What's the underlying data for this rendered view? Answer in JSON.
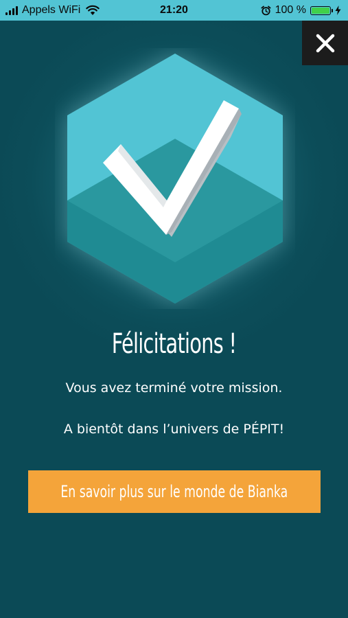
{
  "status_bar": {
    "carrier": "Appels WiFi",
    "time": "21:20",
    "battery": "100 %",
    "icons": [
      "signal-icon",
      "wifi-icon",
      "alarm-icon",
      "battery-icon",
      "charging-bolt-icon"
    ]
  },
  "close_button": {
    "icon": "close-icon",
    "color": "#ffffff"
  },
  "badge": {
    "icon": "checkmark-icon",
    "hexagon_color": "#52c4d4",
    "hexagon_shade_color": "#2a979f"
  },
  "content": {
    "title": "Félicitations !",
    "subtitle": "Vous avez terminé votre mission.",
    "farewell": "A bientôt dans l’univers de PÉPIT!"
  },
  "cta": {
    "label": "En savoir plus sur le monde de Bianka",
    "color": "#f4a43a"
  },
  "colors": {
    "background": "#0c4d59",
    "status_bar": "#52c4d4"
  }
}
